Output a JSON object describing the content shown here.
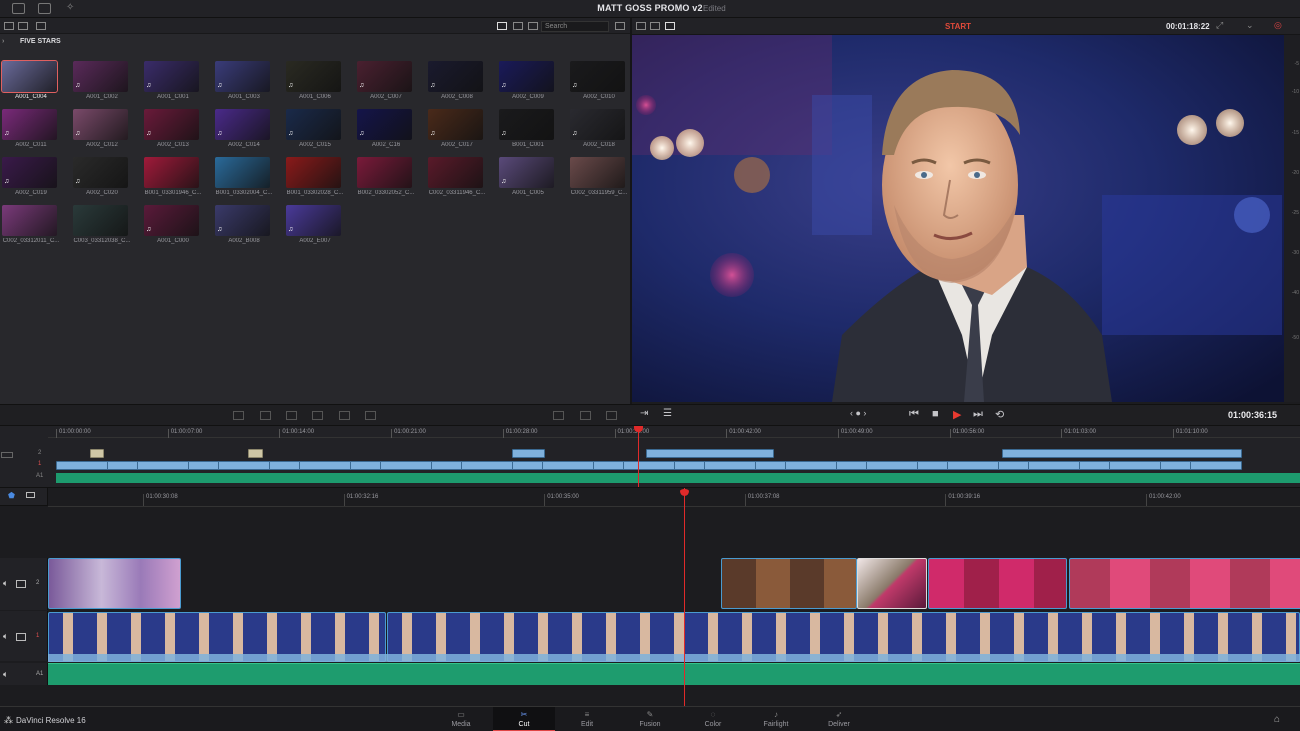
{
  "project": {
    "title": "MATT GOSS PROMO v2",
    "status": "Edited"
  },
  "media_pool": {
    "search_placeholder": "Search",
    "breadcrumb": "FIVE STARS",
    "clips": [
      {
        "name": "A001_C004",
        "color": "#6a6a9a",
        "selected": true,
        "audio": false
      },
      {
        "name": "A001_C002",
        "color": "#5a2a5a",
        "selected": false,
        "audio": true
      },
      {
        "name": "A001_C001",
        "color": "#3a2c6a",
        "selected": false,
        "audio": true
      },
      {
        "name": "A001_C003",
        "color": "#3a3c7a",
        "selected": false,
        "audio": true
      },
      {
        "name": "A001_C006",
        "color": "#2a2a22",
        "selected": false,
        "audio": true
      },
      {
        "name": "A002_C007",
        "color": "#4a2030",
        "selected": false,
        "audio": true
      },
      {
        "name": "A002_C008",
        "color": "#1a1a2e",
        "selected": false,
        "audio": true
      },
      {
        "name": "A002_C009",
        "color": "#1a1a5a",
        "selected": false,
        "audio": true
      },
      {
        "name": "A002_C010",
        "color": "#1a1a1c",
        "selected": false,
        "audio": true
      },
      {
        "name": "A002_C011",
        "color": "#7a2a7a",
        "selected": false,
        "audio": true
      },
      {
        "name": "A002_C012",
        "color": "#7a4a6a",
        "selected": false,
        "audio": true
      },
      {
        "name": "A002_C013",
        "color": "#6a1a3a",
        "selected": false,
        "audio": true
      },
      {
        "name": "A002_C014",
        "color": "#4a2a8a",
        "selected": false,
        "audio": true
      },
      {
        "name": "A002_C015",
        "color": "#1a2a4a",
        "selected": false,
        "audio": true
      },
      {
        "name": "A002_C16",
        "color": "#14144a",
        "selected": false,
        "audio": true
      },
      {
        "name": "A002_C017",
        "color": "#4a2a1a",
        "selected": false,
        "audio": true
      },
      {
        "name": "B001_C001",
        "color": "#1a1a1c",
        "selected": false,
        "audio": true
      },
      {
        "name": "A002_C018",
        "color": "#2a2a30",
        "selected": false,
        "audio": true
      },
      {
        "name": "A002_C019",
        "color": "#3a1a4a",
        "selected": false,
        "audio": true
      },
      {
        "name": "A002_C020",
        "color": "#2a2a2a",
        "selected": false,
        "audio": true
      },
      {
        "name": "B001_03301946_C...",
        "color": "#a01a3a",
        "selected": false,
        "audio": false
      },
      {
        "name": "B001_03302004_C...",
        "color": "#2a6a9a",
        "selected": false,
        "audio": false
      },
      {
        "name": "B001_03302028_C...",
        "color": "#8a1a1a",
        "selected": false,
        "audio": false
      },
      {
        "name": "B002_03302052_C...",
        "color": "#7a1a3a",
        "selected": false,
        "audio": false
      },
      {
        "name": "C002_03311946_C...",
        "color": "#5a1a2a",
        "selected": false,
        "audio": false
      },
      {
        "name": "A001_C005",
        "color": "#5a4a7a",
        "selected": false,
        "audio": true
      },
      {
        "name": "C002_03311959_C...",
        "color": "#6a4a4a",
        "selected": false,
        "audio": false
      },
      {
        "name": "C002_03312011_C...",
        "color": "#7a3a7a",
        "selected": false,
        "audio": false
      },
      {
        "name": "C003_03312038_C...",
        "color": "#2a3a3a",
        "selected": false,
        "audio": false
      },
      {
        "name": "A001_C000",
        "color": "#5a1a3a",
        "selected": false,
        "audio": true
      },
      {
        "name": "A002_B008",
        "color": "#3a3a6a",
        "selected": false,
        "audio": true
      },
      {
        "name": "A002_E007",
        "color": "#4a3a9a",
        "selected": false,
        "audio": true
      }
    ]
  },
  "viewer": {
    "mark": "START",
    "timecode": "00:01:18:22",
    "scale": [
      "-5",
      "-10",
      "-15",
      "-20",
      "-25",
      "-30",
      "-40",
      "-50"
    ]
  },
  "transport": {
    "timecode": "01:00:36:15"
  },
  "upper_timeline": {
    "ticks": [
      "01:00:00:00",
      "01:00:07:00",
      "01:00:14:00",
      "01:00:21:00",
      "01:00:28:00",
      "01:00:35:00",
      "01:00:42:00",
      "01:00:49:00",
      "01:00:56:00",
      "01:01:03:00",
      "01:01:10:00"
    ],
    "tracks": [
      "2",
      "1",
      "A1"
    ]
  },
  "lower_timeline": {
    "ticks": [
      "01:00:30:08",
      "01:00:32:16",
      "01:00:35:00",
      "01:00:37:08",
      "01:00:39:16",
      "01:00:42:00"
    ],
    "tracks": [
      "2",
      "1",
      "A1"
    ]
  },
  "pages": {
    "brand": "DaVinci Resolve 16",
    "tabs": [
      {
        "label": "Media",
        "icon": "▭",
        "active": false
      },
      {
        "label": "Cut",
        "icon": "✂",
        "active": true
      },
      {
        "label": "Edit",
        "icon": "≡",
        "active": false
      },
      {
        "label": "Fusion",
        "icon": "✎",
        "active": false
      },
      {
        "label": "Color",
        "icon": "◌",
        "active": false
      },
      {
        "label": "Fairlight",
        "icon": "♪",
        "active": false
      },
      {
        "label": "Deliver",
        "icon": "➶",
        "active": false
      }
    ]
  },
  "colors": {
    "accent_red": "#e04545",
    "video_clip": "#7fb1dc",
    "audio_clip": "#1d9b6e"
  }
}
